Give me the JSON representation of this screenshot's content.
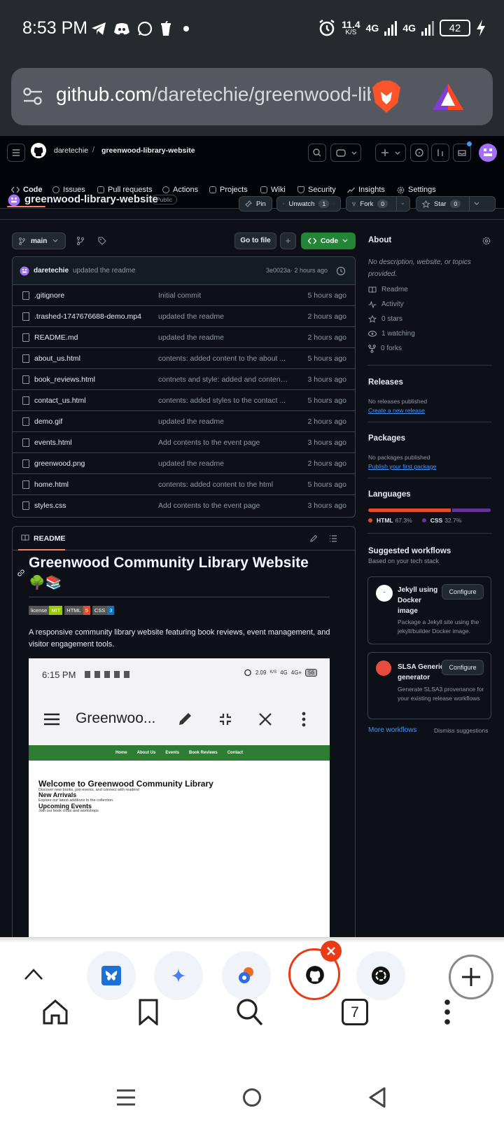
{
  "status_bar": {
    "time": "8:53 PM",
    "speed": "11.4",
    "speed_unit": "K/S",
    "net1": "4G",
    "net2": "4G",
    "battery": "42"
  },
  "browser": {
    "url_host": "github.com",
    "url_path": "/daretechie/greenwood-lib"
  },
  "github_header": {
    "owner": "daretechie",
    "separator": "/",
    "repo": "greenwood-library-website"
  },
  "tabs": [
    {
      "label": "Code",
      "icon": "code-icon"
    },
    {
      "label": "Issues",
      "icon": "issue-icon"
    },
    {
      "label": "Pull requests",
      "icon": "pull-request-icon"
    },
    {
      "label": "Actions",
      "icon": "play-icon"
    },
    {
      "label": "Projects",
      "icon": "table-icon"
    },
    {
      "label": "Wiki",
      "icon": "book-icon"
    },
    {
      "label": "Security",
      "icon": "shield-icon"
    },
    {
      "label": "Insights",
      "icon": "graph-icon"
    },
    {
      "label": "Settings",
      "icon": "gear-icon"
    }
  ],
  "repo": {
    "name": "greenwood-library-website",
    "visibility": "Public",
    "pin": "Pin",
    "unwatch": "Unwatch",
    "watch_count": "1",
    "fork": "Fork",
    "fork_count": "0",
    "star": "Star",
    "star_count": "0"
  },
  "toolbar": {
    "branch": "main",
    "go_to_file": "Go to file",
    "add": "+",
    "code": "Code"
  },
  "commit": {
    "author": "daretechie",
    "message": "updated the readme",
    "sha": "3e0023a",
    "time": "· 2 hours ago"
  },
  "files": [
    {
      "name": ".gitignore",
      "message": "Initial commit",
      "age": "5 hours ago"
    },
    {
      "name": ".trashed-1747676688-demo.mp4",
      "message": "updated the readme",
      "age": "2 hours ago"
    },
    {
      "name": "README.md",
      "message": "updated the readme",
      "age": "2 hours ago"
    },
    {
      "name": "about_us.html",
      "message": "contents: added content to the about ...",
      "age": "5 hours ago"
    },
    {
      "name": "book_reviews.html",
      "message": "contnets and style: added and content...",
      "age": "3 hours ago"
    },
    {
      "name": "contact_us.html",
      "message": "contents: added styles to the contact ...",
      "age": "5 hours ago"
    },
    {
      "name": "demo.gif",
      "message": "updated the readme",
      "age": "2 hours ago"
    },
    {
      "name": "events.html",
      "message": "Add contents to the event page",
      "age": "3 hours ago"
    },
    {
      "name": "greenwood.png",
      "message": "updated the readme",
      "age": "2 hours ago"
    },
    {
      "name": "home.html",
      "message": "contents: added content to the html",
      "age": "5 hours ago"
    },
    {
      "name": "styles.css",
      "message": "Add contents to the event page",
      "age": "3 hours ago"
    }
  ],
  "readme": {
    "tab": "README",
    "title": "Greenwood Community Library Website",
    "emoji": "🌳📚",
    "badges": [
      {
        "left": "license",
        "right": "MIT",
        "color": "#97ca00"
      },
      {
        "left": "HTML",
        "right": "5",
        "color": "#e34c26"
      },
      {
        "left": "CSS",
        "right": "3",
        "color": "#1572b6"
      }
    ],
    "description": "A responsive community library website featuring book reviews, event management, and visitor engagement tools.",
    "preview": {
      "time": "6:15 PM",
      "speed": "2.09",
      "speed_unit": "K/S",
      "net1": "4G",
      "net2": "4G+",
      "battery": "56",
      "app_title": "Greenwoo...",
      "nav": [
        "Home",
        "About Us",
        "Events",
        "Book Reviews",
        "Contact"
      ],
      "heading": "Welcome to Greenwood Community Library",
      "sub": "Discover new books, join events, and connect with readers!",
      "arrivals_title": "New Arrivals",
      "arrivals_text": "Explore our latest additions to the collection.",
      "events_title": "Upcoming Events",
      "events_text": "Join our book clubs and workshops"
    }
  },
  "about": {
    "title": "About",
    "description": "No description, website, or topics provided.",
    "items": [
      {
        "label": "Readme",
        "icon": "book-icon"
      },
      {
        "label": "Activity",
        "icon": "pulse-icon"
      },
      {
        "label": "0 stars",
        "icon": "star-icon"
      },
      {
        "label": "1 watching",
        "icon": "eye-icon"
      },
      {
        "label": "0 forks",
        "icon": "fork-icon"
      }
    ]
  },
  "releases": {
    "title": "Releases",
    "empty": "No releases published",
    "link": "Create a new release"
  },
  "packages": {
    "title": "Packages",
    "empty": "No packages published",
    "link": "Publish your first package"
  },
  "languages": {
    "title": "Languages",
    "items": [
      {
        "name": "HTML",
        "percent": "67.3%",
        "value": 67.3,
        "color": "#e34c26"
      },
      {
        "name": "CSS",
        "percent": "32.7%",
        "value": 32.7,
        "color": "#663399"
      }
    ]
  },
  "workflows": {
    "title": "Suggested workflows",
    "subtitle": "Based on your tech stack",
    "items": [
      {
        "name": "Jekyll using Docker image",
        "desc": "Package a Jekyll site using the jekyll/builder Docker image.",
        "button": "Configure"
      },
      {
        "name": "SLSA Generic generator",
        "desc": "Generate SLSA3 provenance for your existing release workflows",
        "button": "Configure"
      }
    ],
    "more": "More workflows",
    "dismiss": "Dismiss suggestions"
  },
  "bottom_bar": {
    "tab_count": "7"
  }
}
